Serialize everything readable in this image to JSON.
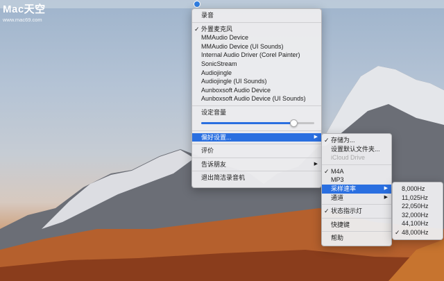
{
  "colors": {
    "accent": "#2a6fe0",
    "menu_bg": "#ececee"
  },
  "watermark": {
    "logo": "Mac天空",
    "url": "www.mac69.com"
  },
  "menubar": {
    "icon": "app-record-icon"
  },
  "main_menu": {
    "record_label": "录音",
    "devices": [
      {
        "label": "外置麦克风",
        "checked": true
      },
      {
        "label": "MMAudio Device",
        "checked": false
      },
      {
        "label": "MMAudio Device (UI Sounds)",
        "checked": false
      },
      {
        "label": "Internal Audio Driver (Corel Painter)",
        "checked": false
      },
      {
        "label": "SonicStream",
        "checked": false
      },
      {
        "label": "Audiojingle",
        "checked": false
      },
      {
        "label": "Audiojingle (UI Sounds)",
        "checked": false
      },
      {
        "label": "Aunboxsoft Audio Device",
        "checked": false
      },
      {
        "label": "Aunboxsoft Audio Device (UI Sounds)",
        "checked": false
      }
    ],
    "volume_label": "设定音量",
    "volume_level": 0.82,
    "prefs_label": "偏好设置...",
    "rate_label": "评价",
    "share_label": "告诉朋友",
    "quit_label": "退出简洁录音机"
  },
  "prefs_menu": {
    "save_as_label": "存储为...",
    "default_folder_label": "设置默认文件夹...",
    "icloud_label": "iCloud Drive",
    "formats": [
      {
        "label": "M4A",
        "checked": true
      },
      {
        "label": "MP3",
        "checked": false
      }
    ],
    "sample_rate_label": "采样速率",
    "channels_label": "通道",
    "status_light_label": "状态指示灯",
    "status_light_checked": true,
    "shortcuts_label": "快捷键",
    "help_label": "帮助"
  },
  "rates_menu": {
    "rates": [
      {
        "label": "8,000Hz",
        "checked": false
      },
      {
        "label": "11,025Hz",
        "checked": false
      },
      {
        "label": "22,050Hz",
        "checked": false
      },
      {
        "label": "32,000Hz",
        "checked": false
      },
      {
        "label": "44,100Hz",
        "checked": false
      },
      {
        "label": "48,000Hz",
        "checked": true
      }
    ]
  }
}
